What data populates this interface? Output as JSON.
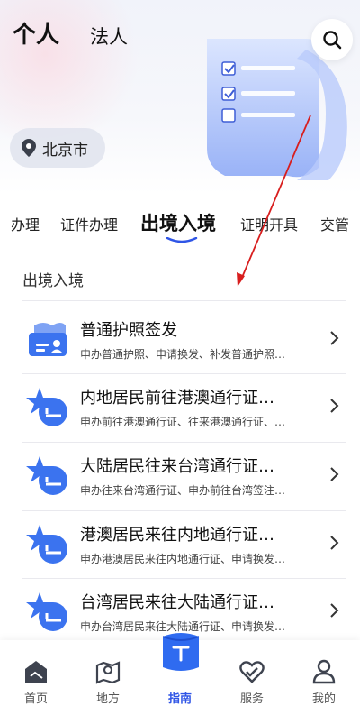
{
  "header": {
    "tab_personal": "个人",
    "tab_legal": "法人",
    "search_icon": "search-icon"
  },
  "city": {
    "label": "北京市",
    "icon": "location-pin-icon"
  },
  "categories": [
    "办理",
    "证件办理",
    "出境入境",
    "证明开具",
    "交管"
  ],
  "active_category": "出境入境",
  "section": {
    "title": "出境入境"
  },
  "items": [
    {
      "title": "普通护照签发",
      "subtitle": "申办普通护照、申请换发、补发普通护照…",
      "icon": "passport-card-icon"
    },
    {
      "title": "内地居民前往港澳通行证…",
      "subtitle": "申办前往港澳通行证、往来港澳通行证、…",
      "icon": "star-plane-icon"
    },
    {
      "title": "大陆居民往来台湾通行证…",
      "subtitle": "申办往来台湾通行证、申办前往台湾签注…",
      "icon": "star-plane-icon"
    },
    {
      "title": "港澳居民来往内地通行证…",
      "subtitle": "申办港澳居民来往内地通行证、申请换发…",
      "icon": "star-plane-icon"
    },
    {
      "title": "台湾居民来往大陆通行证…",
      "subtitle": "申办台湾居民来往大陆通行证、申请换发…",
      "icon": "star-plane-icon"
    }
  ],
  "bottom_nav": [
    {
      "label": "首页",
      "icon": "home-icon"
    },
    {
      "label": "地方",
      "icon": "map-icon"
    },
    {
      "label": "指南",
      "icon": "guide-box-icon"
    },
    {
      "label": "服务",
      "icon": "service-heart-icon"
    },
    {
      "label": "我的",
      "icon": "user-icon"
    }
  ],
  "colors": {
    "accent": "#2f55e6",
    "icon_blue": "#3b73ef",
    "annotation_red": "#d81e1e"
  }
}
